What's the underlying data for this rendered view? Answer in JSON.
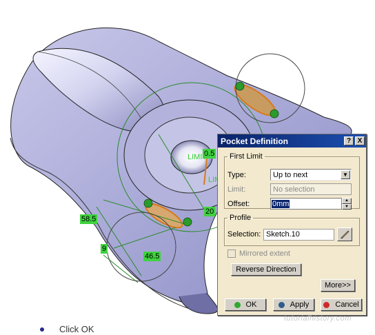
{
  "dialog": {
    "title": "Pocket Definition",
    "help_label": "?",
    "close_label": "X",
    "first_limit": {
      "legend": "First Limit",
      "type_label": "Type:",
      "type_value": "Up to next",
      "limit_label": "Limit:",
      "limit_value": "No selection",
      "offset_label": "Offset:",
      "offset_value": "0mm"
    },
    "profile": {
      "legend": "Profile",
      "selection_label": "Selection:",
      "selection_value": "Sketch.10"
    },
    "mirrored_label": "Mirrored extent",
    "reverse_label": "Reverse Direction",
    "more_label": "More>>",
    "ok_label": "OK",
    "apply_label": "Apply",
    "cancel_label": "Cancel",
    "colors": {
      "ok": "#2fa82f",
      "apply": "#2e5c8a",
      "cancel": "#cc2a2a"
    }
  },
  "viewport": {
    "dimensions": [
      "58.5",
      "9",
      "46.5",
      "20",
      "0.5"
    ],
    "limit_label": "LIMIT",
    "limit_label_2": "LIM"
  },
  "caption": {
    "text": "Click OK"
  },
  "watermark": "tutorialhistory.com"
}
